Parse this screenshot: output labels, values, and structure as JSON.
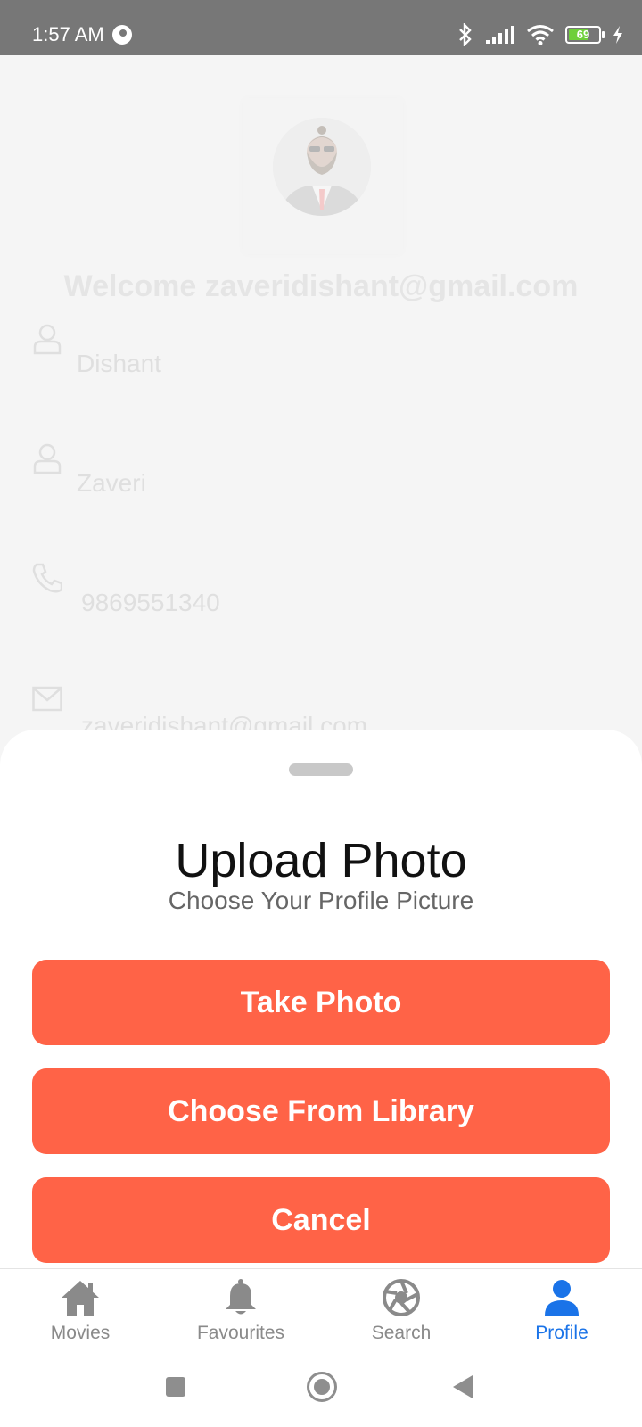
{
  "status_bar": {
    "time": "1:57 AM",
    "battery_level": "69",
    "battery_fill_color": "#6ecf3a",
    "icons": [
      "app-notification-icon",
      "bluetooth-icon",
      "signal-icon",
      "wifi-icon",
      "battery-icon",
      "charging-icon"
    ]
  },
  "profile": {
    "welcome_text": "Welcome zaveridishant@gmail.com",
    "fields": [
      {
        "icon": "person-icon",
        "value": "Dishant"
      },
      {
        "icon": "person-icon",
        "value": "Zaveri"
      },
      {
        "icon": "phone-icon",
        "value": "9869551340"
      },
      {
        "icon": "mail-icon",
        "value": "zaveridishant@gmail.com"
      }
    ]
  },
  "sheet": {
    "title": "Upload Photo",
    "subtitle": "Choose Your Profile Picture",
    "take_photo_label": "Take Photo",
    "library_label": "Choose From Library",
    "cancel_label": "Cancel",
    "button_color": "#ff6347"
  },
  "tabs": [
    {
      "label": "Movies",
      "icon": "home-icon",
      "active": false
    },
    {
      "label": "Favourites",
      "icon": "bell-icon",
      "active": false
    },
    {
      "label": "Search",
      "icon": "aperture-icon",
      "active": false
    },
    {
      "label": "Profile",
      "icon": "profile-icon",
      "active": true
    }
  ],
  "colors": {
    "accent": "#1a73e8",
    "inactive_tab": "#8a8a8a",
    "status_bar": "#777777"
  }
}
